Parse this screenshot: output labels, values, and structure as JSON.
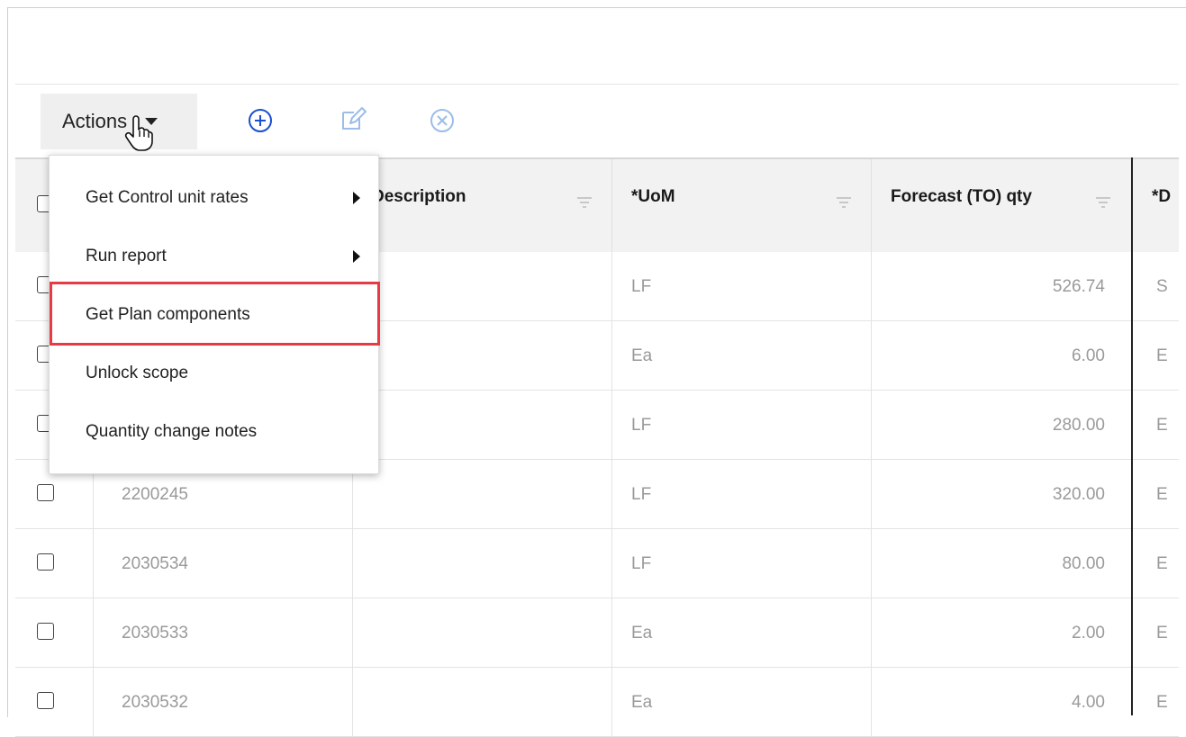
{
  "toolbar": {
    "actions_label": "Actions",
    "icons": [
      "add-circle-icon",
      "edit-icon",
      "cancel-circle-icon"
    ],
    "add_color": "#1a4fd1",
    "muted_color": "#9bbde8"
  },
  "menu": {
    "items": [
      {
        "label": "Get Control unit rates",
        "submenu": true
      },
      {
        "label": "Run report",
        "submenu": true
      },
      {
        "label": "Get Plan components",
        "submenu": false,
        "highlighted": true
      },
      {
        "label": "Unlock scope",
        "submenu": false
      },
      {
        "label": "Quantity change notes",
        "submenu": false
      }
    ],
    "highlight_color": "#e63a44"
  },
  "table": {
    "columns": [
      {
        "label": ""
      },
      {
        "label": ""
      },
      {
        "label": "Description"
      },
      {
        "label": "*UoM"
      },
      {
        "label": "Forecast (TO) qty"
      },
      {
        "label": "*D"
      }
    ],
    "description_header_partial": "Description",
    "rows": [
      {
        "id": "",
        "uom": "LF",
        "qty": "526.74",
        "d": "S"
      },
      {
        "id": "",
        "uom": "Ea",
        "qty": "6.00",
        "d": "E"
      },
      {
        "id": "",
        "uom": "LF",
        "qty": "280.00",
        "d": "E"
      },
      {
        "id": "2200245",
        "uom": "LF",
        "qty": "320.00",
        "d": "E"
      },
      {
        "id": "2030534",
        "uom": "LF",
        "qty": "80.00",
        "d": "E"
      },
      {
        "id": "2030533",
        "uom": "Ea",
        "qty": "2.00",
        "d": "E"
      },
      {
        "id": "2030532",
        "uom": "Ea",
        "qty": "4.00",
        "d": "E"
      }
    ]
  }
}
